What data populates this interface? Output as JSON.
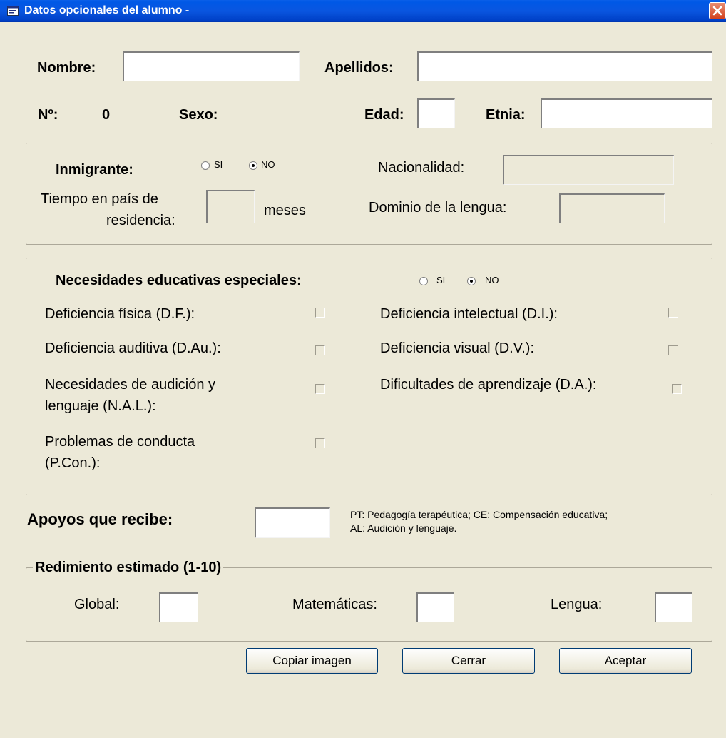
{
  "window": {
    "title": "Datos opcionales del alumno -"
  },
  "header": {
    "nombre_label": "Nombre:",
    "nombre_value": "",
    "apellidos_label": "Apellidos:",
    "apellidos_value": "",
    "numero_label": "Nº:",
    "numero_value": "0",
    "sexo_label": "Sexo:",
    "edad_label": "Edad:",
    "edad_value": "",
    "etnia_label": "Etnia:",
    "etnia_value": ""
  },
  "inmigrante": {
    "label": "Inmigrante:",
    "options": [
      "SI",
      "NO"
    ],
    "selected": "NO",
    "nacionalidad_label": "Nacionalidad:",
    "tiempo_label_1": "Tiempo en país de",
    "tiempo_label_2": "residencia:",
    "meses_label": "meses",
    "dominio_label": "Dominio de la lengua:"
  },
  "nee": {
    "label": "Necesidades educativas especiales:",
    "options": [
      "SI",
      "NO"
    ],
    "selected": "NO",
    "items": [
      {
        "l1": "Deficiencia física (D.F.):",
        "l2": ""
      },
      {
        "l1": "Deficiencia intelectual (D.I.):",
        "l2": ""
      },
      {
        "l1": "Deficiencia auditiva (D.Au.):",
        "l2": ""
      },
      {
        "l1": "Deficiencia visual (D.V.):",
        "l2": ""
      },
      {
        "l1": "Necesidades de audición y",
        "l2": "lenguaje (N.A.L.):"
      },
      {
        "l1": "Dificultades de aprendizaje (D.A.):",
        "l2": ""
      },
      {
        "l1": "Problemas de conducta",
        "l2": "(P.Con.):"
      }
    ]
  },
  "apoyos": {
    "label": "Apoyos que recibe:",
    "value": "",
    "hint_1": "PT: Pedagogía terapéutica; CE: Compensación educativa;",
    "hint_2": "AL: Audición y lenguaje."
  },
  "rendimiento": {
    "legend": "Redimiento estimado (1-10)",
    "global_label": "Global:",
    "matematicas_label": "Matemáticas:",
    "lengua_label": "Lengua:"
  },
  "buttons": {
    "copiar": "Copiar imagen",
    "cerrar": "Cerrar",
    "aceptar": "Aceptar"
  },
  "colors": {
    "titlebar": "#0058e6",
    "face": "#ece9d8",
    "close": "#d3421f"
  }
}
